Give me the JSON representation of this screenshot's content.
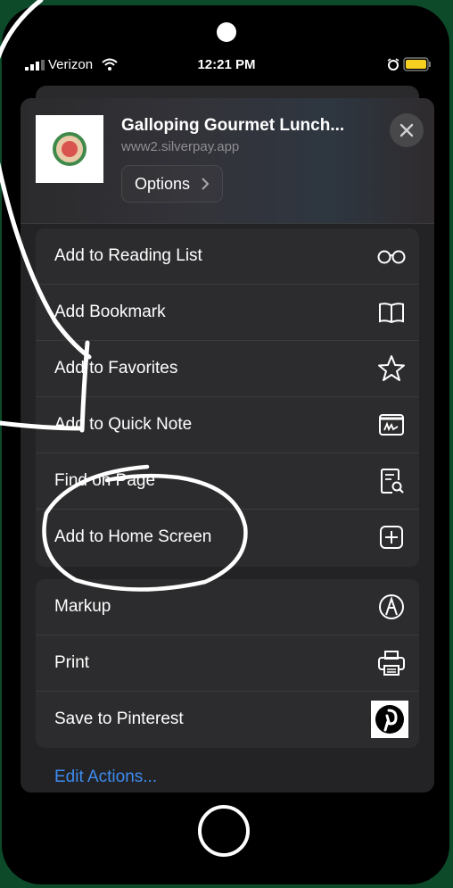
{
  "status_bar": {
    "carrier": "Verizon",
    "time": "12:21 PM",
    "battery_color": "#f5d020"
  },
  "share_sheet": {
    "app_title": "Galloping Gourmet Lunch...",
    "app_url": "www2.silverpay.app",
    "options_label": "Options",
    "close_icon": "close-icon",
    "group1": [
      {
        "label": "Add to Reading List",
        "icon": "glasses-icon"
      },
      {
        "label": "Add Bookmark",
        "icon": "book-icon"
      },
      {
        "label": "Add to Favorites",
        "icon": "star-icon"
      },
      {
        "label": "Add to Quick Note",
        "icon": "quick-note-icon"
      },
      {
        "label": "Find on Page",
        "icon": "find-on-page-icon"
      },
      {
        "label": "Add to Home Screen",
        "icon": "plus-square-icon"
      }
    ],
    "group2": [
      {
        "label": "Markup",
        "icon": "markup-pen-icon"
      },
      {
        "label": "Print",
        "icon": "printer-icon"
      },
      {
        "label": "Save to Pinterest",
        "icon": "pinterest-icon"
      }
    ],
    "edit_actions_label": "Edit Actions...",
    "accent_color": "#3d8cf0"
  }
}
